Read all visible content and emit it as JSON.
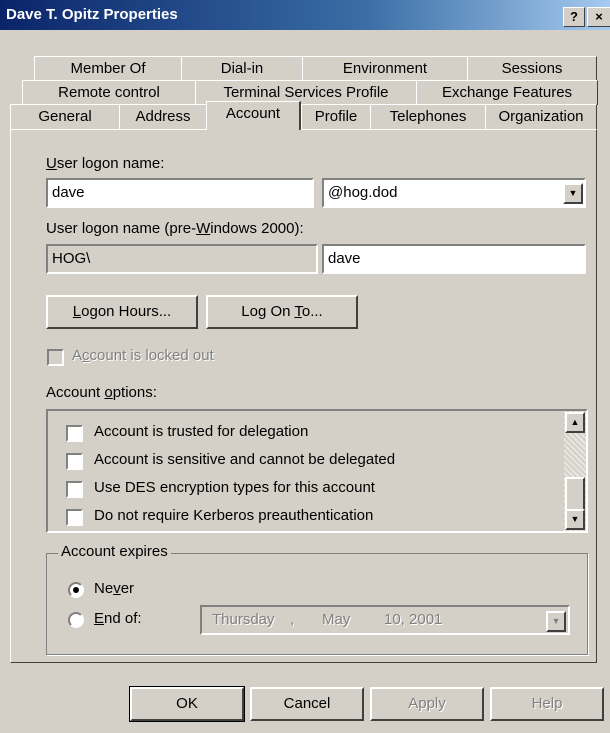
{
  "window": {
    "title": "Dave T. Opitz Properties",
    "help_btn": "?",
    "close_btn": "×"
  },
  "tabs": {
    "row1": [
      "Member Of",
      "Dial-in",
      "Environment",
      "Sessions"
    ],
    "row2": [
      "Remote control",
      "Terminal Services Profile",
      "Exchange Features"
    ],
    "row3": [
      "General",
      "Address",
      "Account",
      "Profile",
      "Telephones",
      "Organization"
    ],
    "active": "Account"
  },
  "account": {
    "logon_label_pre": "",
    "logon_label_u": "U",
    "logon_label_post": "ser logon name:",
    "logon_value": "dave",
    "domain_value": "@hog.dod",
    "pre2000_label_pre": "User logon name (pre-",
    "pre2000_label_u": "W",
    "pre2000_label_post": "indows 2000):",
    "pre2000_domain": "HOG\\",
    "pre2000_user": "dave",
    "logon_hours_u": "L",
    "logon_hours_rest": "ogon Hours...",
    "logon_to_pre": "Log On ",
    "logon_to_u": "T",
    "logon_to_post": "o...",
    "locked_pre": "A",
    "locked_u": "c",
    "locked_post": "count is locked out",
    "options_pre": "Account ",
    "options_u": "o",
    "options_post": "ptions:",
    "options": [
      "Account is trusted for delegation",
      "Account is sensitive and cannot be delegated",
      "Use DES encryption types for this account",
      "Do not require Kerberos preauthentication"
    ],
    "expires_label": "Account expires",
    "never_pre": "Ne",
    "never_u": "v",
    "never_post": "er",
    "endof_u": "E",
    "endof_post": "nd of:",
    "date_day": "Thursday",
    "date_sep": ",",
    "date_month": "May",
    "date_rest": "10, 2001"
  },
  "buttons": {
    "ok": "OK",
    "cancel": "Cancel",
    "apply": "Apply",
    "help": "Help"
  }
}
